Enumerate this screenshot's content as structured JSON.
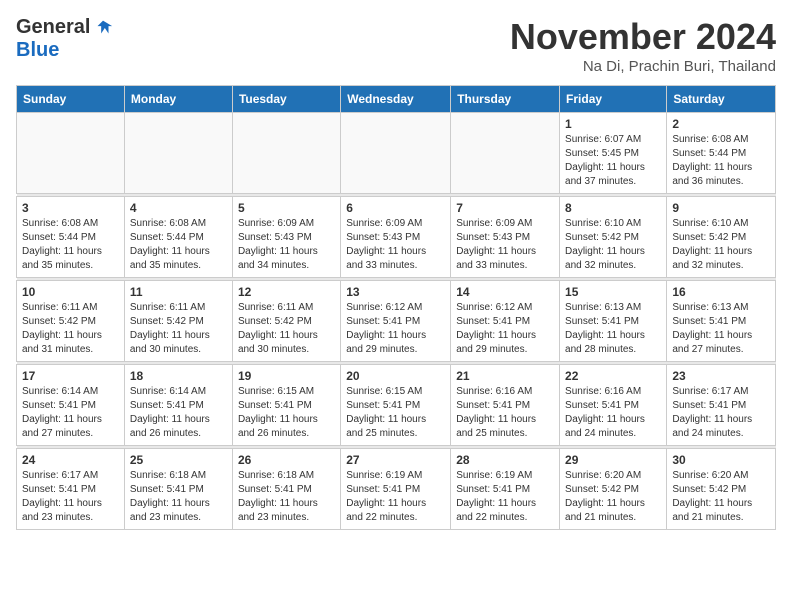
{
  "logo": {
    "general": "General",
    "blue": "Blue"
  },
  "header": {
    "month": "November 2024",
    "location": "Na Di, Prachin Buri, Thailand"
  },
  "days_of_week": [
    "Sunday",
    "Monday",
    "Tuesday",
    "Wednesday",
    "Thursday",
    "Friday",
    "Saturday"
  ],
  "weeks": [
    [
      {
        "day": "",
        "info": ""
      },
      {
        "day": "",
        "info": ""
      },
      {
        "day": "",
        "info": ""
      },
      {
        "day": "",
        "info": ""
      },
      {
        "day": "",
        "info": ""
      },
      {
        "day": "1",
        "info": "Sunrise: 6:07 AM\nSunset: 5:45 PM\nDaylight: 11 hours and 37 minutes."
      },
      {
        "day": "2",
        "info": "Sunrise: 6:08 AM\nSunset: 5:44 PM\nDaylight: 11 hours and 36 minutes."
      }
    ],
    [
      {
        "day": "3",
        "info": "Sunrise: 6:08 AM\nSunset: 5:44 PM\nDaylight: 11 hours and 35 minutes."
      },
      {
        "day": "4",
        "info": "Sunrise: 6:08 AM\nSunset: 5:44 PM\nDaylight: 11 hours and 35 minutes."
      },
      {
        "day": "5",
        "info": "Sunrise: 6:09 AM\nSunset: 5:43 PM\nDaylight: 11 hours and 34 minutes."
      },
      {
        "day": "6",
        "info": "Sunrise: 6:09 AM\nSunset: 5:43 PM\nDaylight: 11 hours and 33 minutes."
      },
      {
        "day": "7",
        "info": "Sunrise: 6:09 AM\nSunset: 5:43 PM\nDaylight: 11 hours and 33 minutes."
      },
      {
        "day": "8",
        "info": "Sunrise: 6:10 AM\nSunset: 5:42 PM\nDaylight: 11 hours and 32 minutes."
      },
      {
        "day": "9",
        "info": "Sunrise: 6:10 AM\nSunset: 5:42 PM\nDaylight: 11 hours and 32 minutes."
      }
    ],
    [
      {
        "day": "10",
        "info": "Sunrise: 6:11 AM\nSunset: 5:42 PM\nDaylight: 11 hours and 31 minutes."
      },
      {
        "day": "11",
        "info": "Sunrise: 6:11 AM\nSunset: 5:42 PM\nDaylight: 11 hours and 30 minutes."
      },
      {
        "day": "12",
        "info": "Sunrise: 6:11 AM\nSunset: 5:42 PM\nDaylight: 11 hours and 30 minutes."
      },
      {
        "day": "13",
        "info": "Sunrise: 6:12 AM\nSunset: 5:41 PM\nDaylight: 11 hours and 29 minutes."
      },
      {
        "day": "14",
        "info": "Sunrise: 6:12 AM\nSunset: 5:41 PM\nDaylight: 11 hours and 29 minutes."
      },
      {
        "day": "15",
        "info": "Sunrise: 6:13 AM\nSunset: 5:41 PM\nDaylight: 11 hours and 28 minutes."
      },
      {
        "day": "16",
        "info": "Sunrise: 6:13 AM\nSunset: 5:41 PM\nDaylight: 11 hours and 27 minutes."
      }
    ],
    [
      {
        "day": "17",
        "info": "Sunrise: 6:14 AM\nSunset: 5:41 PM\nDaylight: 11 hours and 27 minutes."
      },
      {
        "day": "18",
        "info": "Sunrise: 6:14 AM\nSunset: 5:41 PM\nDaylight: 11 hours and 26 minutes."
      },
      {
        "day": "19",
        "info": "Sunrise: 6:15 AM\nSunset: 5:41 PM\nDaylight: 11 hours and 26 minutes."
      },
      {
        "day": "20",
        "info": "Sunrise: 6:15 AM\nSunset: 5:41 PM\nDaylight: 11 hours and 25 minutes."
      },
      {
        "day": "21",
        "info": "Sunrise: 6:16 AM\nSunset: 5:41 PM\nDaylight: 11 hours and 25 minutes."
      },
      {
        "day": "22",
        "info": "Sunrise: 6:16 AM\nSunset: 5:41 PM\nDaylight: 11 hours and 24 minutes."
      },
      {
        "day": "23",
        "info": "Sunrise: 6:17 AM\nSunset: 5:41 PM\nDaylight: 11 hours and 24 minutes."
      }
    ],
    [
      {
        "day": "24",
        "info": "Sunrise: 6:17 AM\nSunset: 5:41 PM\nDaylight: 11 hours and 23 minutes."
      },
      {
        "day": "25",
        "info": "Sunrise: 6:18 AM\nSunset: 5:41 PM\nDaylight: 11 hours and 23 minutes."
      },
      {
        "day": "26",
        "info": "Sunrise: 6:18 AM\nSunset: 5:41 PM\nDaylight: 11 hours and 23 minutes."
      },
      {
        "day": "27",
        "info": "Sunrise: 6:19 AM\nSunset: 5:41 PM\nDaylight: 11 hours and 22 minutes."
      },
      {
        "day": "28",
        "info": "Sunrise: 6:19 AM\nSunset: 5:41 PM\nDaylight: 11 hours and 22 minutes."
      },
      {
        "day": "29",
        "info": "Sunrise: 6:20 AM\nSunset: 5:42 PM\nDaylight: 11 hours and 21 minutes."
      },
      {
        "day": "30",
        "info": "Sunrise: 6:20 AM\nSunset: 5:42 PM\nDaylight: 11 hours and 21 minutes."
      }
    ]
  ]
}
